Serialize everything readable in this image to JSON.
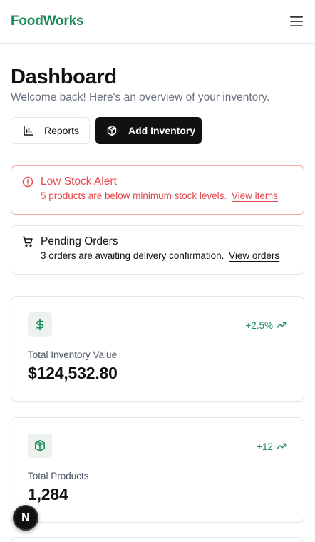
{
  "header": {
    "brand": "FoodWorks",
    "menu_icon": "hamburger-menu-icon"
  },
  "page": {
    "title": "Dashboard",
    "subtitle": "Welcome back! Here's an overview of your inventory."
  },
  "actions": {
    "reports_label": "Reports",
    "reports_icon": "bar-chart-icon",
    "add_label": "Add Inventory",
    "add_icon": "package-icon"
  },
  "alerts": {
    "low_stock": {
      "title": "Low Stock Alert",
      "message": "5 products are below minimum stock levels.",
      "link": "View items",
      "icon": "alert-circle-icon",
      "color": "#e5484d"
    },
    "pending_orders": {
      "title": "Pending Orders",
      "message": "3 orders are awaiting delivery confirmation.",
      "link": "View orders",
      "icon": "shopping-cart-icon"
    }
  },
  "stats": [
    {
      "label": "Total Inventory Value",
      "value": "$124,532.80",
      "trend": "+2.5%",
      "icon": "dollar-icon"
    },
    {
      "label": "Total Products",
      "value": "1,284",
      "trend": "+12",
      "icon": "package-icon"
    }
  ],
  "fab": {
    "letter": "N"
  },
  "colors": {
    "brand": "#1a8a5c",
    "accent_dark": "#111111",
    "danger": "#e5484d"
  }
}
